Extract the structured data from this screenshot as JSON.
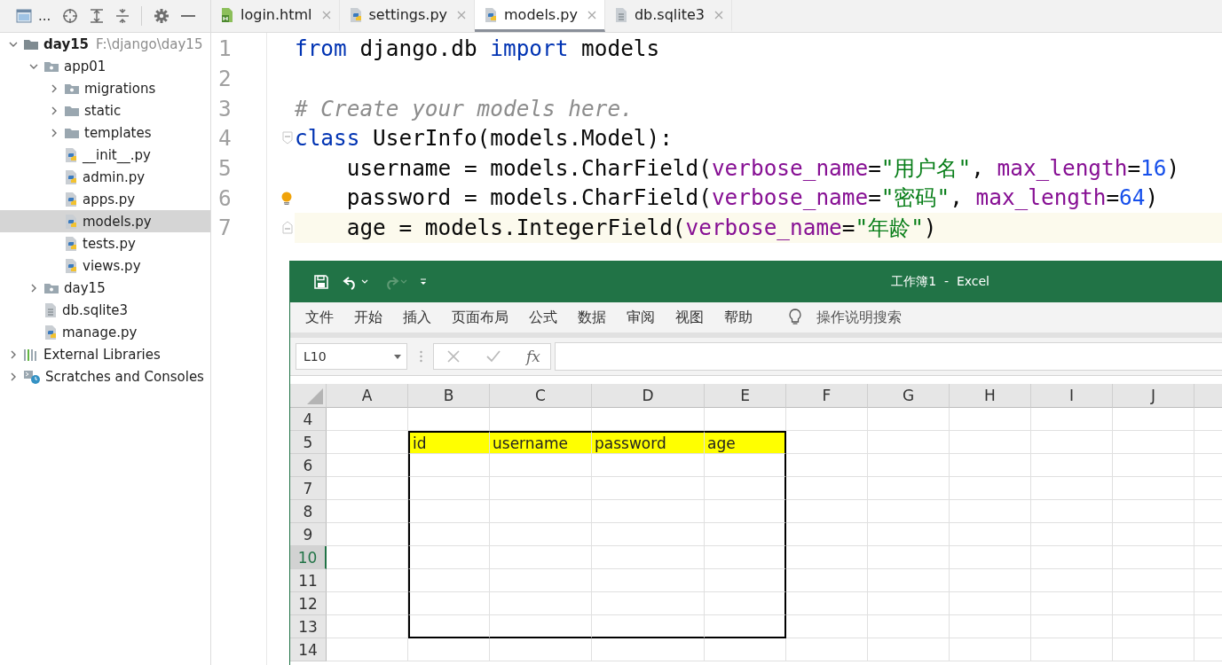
{
  "ide": {
    "toolbar": {
      "project_label": "..."
    },
    "tabs": [
      {
        "label": "login.html",
        "kind": "html",
        "selected": false
      },
      {
        "label": "settings.py",
        "kind": "python",
        "selected": false
      },
      {
        "label": "models.py",
        "kind": "python",
        "selected": true
      },
      {
        "label": "db.sqlite3",
        "kind": "text",
        "selected": false
      }
    ],
    "project_tree": [
      {
        "label": "day15",
        "path": "F:\\django\\day15",
        "kind": "root",
        "expanded": true,
        "selected": false,
        "children": [
          {
            "label": "app01",
            "kind": "package",
            "expanded": true,
            "selected": false,
            "children": [
              {
                "label": "migrations",
                "kind": "package",
                "expanded": false,
                "selected": false
              },
              {
                "label": "static",
                "kind": "folder",
                "expanded": false,
                "selected": false
              },
              {
                "label": "templates",
                "kind": "folder",
                "expanded": false,
                "selected": false
              },
              {
                "label": "__init__.py",
                "kind": "python",
                "selected": false
              },
              {
                "label": "admin.py",
                "kind": "python",
                "selected": false
              },
              {
                "label": "apps.py",
                "kind": "python",
                "selected": false
              },
              {
                "label": "models.py",
                "kind": "python",
                "selected": true
              },
              {
                "label": "tests.py",
                "kind": "python",
                "selected": false
              },
              {
                "label": "views.py",
                "kind": "python",
                "selected": false
              }
            ]
          },
          {
            "label": "day15",
            "kind": "package",
            "expanded": false,
            "selected": false
          },
          {
            "label": "db.sqlite3",
            "kind": "text",
            "selected": false
          },
          {
            "label": "manage.py",
            "kind": "python",
            "selected": false
          }
        ]
      },
      {
        "label": "External Libraries",
        "kind": "library",
        "expanded": false,
        "selected": false
      },
      {
        "label": "Scratches and Consoles",
        "kind": "scratches",
        "expanded": false,
        "selected": false
      }
    ],
    "editor": {
      "lines": [
        {
          "number": "1",
          "kind": "plain",
          "current": false,
          "tokens": [
            {
              "kind": "keyword",
              "text": "from"
            },
            {
              "kind": "plain",
              "text": " django.db "
            },
            {
              "kind": "keyword",
              "text": "import"
            },
            {
              "kind": "plain",
              "text": " models"
            }
          ]
        },
        {
          "number": "2",
          "kind": "plain",
          "current": false
        },
        {
          "number": "3",
          "kind": "plain",
          "current": false,
          "tokens": [
            {
              "kind": "comment",
              "text": "# Create your models here."
            }
          ]
        },
        {
          "number": "4",
          "kind": "fold-start",
          "current": false,
          "tokens": [
            {
              "kind": "keyword",
              "text": "class"
            },
            {
              "kind": "plain",
              "text": " UserInfo(models.Model):"
            }
          ]
        },
        {
          "number": "5",
          "kind": "plain",
          "current": false,
          "tokens": [
            {
              "kind": "plain",
              "text": "    username = models.CharField("
            },
            {
              "kind": "param",
              "text": "verbose_name"
            },
            {
              "kind": "plain",
              "text": "="
            },
            {
              "kind": "string",
              "text": "\"用户名\""
            },
            {
              "kind": "plain",
              "text": ", "
            },
            {
              "kind": "param",
              "text": "max_length"
            },
            {
              "kind": "plain",
              "text": "="
            },
            {
              "kind": "number",
              "text": "16"
            },
            {
              "kind": "plain",
              "text": ")"
            }
          ]
        },
        {
          "number": "6",
          "kind": "bulb",
          "current": false,
          "tokens": [
            {
              "kind": "plain",
              "text": "    password = models.CharField("
            },
            {
              "kind": "param",
              "text": "verbose_name"
            },
            {
              "kind": "plain",
              "text": "="
            },
            {
              "kind": "string",
              "text": "\"密码\""
            },
            {
              "kind": "plain",
              "text": ", "
            },
            {
              "kind": "param",
              "text": "max_length"
            },
            {
              "kind": "plain",
              "text": "="
            },
            {
              "kind": "number",
              "text": "64"
            },
            {
              "kind": "plain",
              "text": ")"
            }
          ]
        },
        {
          "number": "7",
          "kind": "fold-end",
          "current": true,
          "tokens": [
            {
              "kind": "plain",
              "text": "    age = models.IntegerField("
            },
            {
              "kind": "param",
              "text": "verbose_name"
            },
            {
              "kind": "plain",
              "text": "="
            },
            {
              "kind": "string",
              "text": "\"年龄\""
            },
            {
              "kind": "plain",
              "text": ")"
            }
          ]
        }
      ]
    }
  },
  "excel": {
    "title": "工作簿1  -  Excel",
    "menu": [
      "文件",
      "开始",
      "插入",
      "页面布局",
      "公式",
      "数据",
      "审阅",
      "视图",
      "帮助"
    ],
    "search": "操作说明搜索",
    "name_box": "L10",
    "function_label": "fx",
    "columns": [
      "A",
      "B",
      "C",
      "D",
      "E",
      "F",
      "G",
      "H",
      "I",
      "J"
    ],
    "rows": [
      {
        "number": "4",
        "selected": false
      },
      {
        "number": "5",
        "selected": false,
        "cells": [
          {
            "text": "",
            "highlighted": false
          },
          {
            "text": "id",
            "highlighted": true
          },
          {
            "text": "username",
            "highlighted": true
          },
          {
            "text": "password",
            "highlighted": true
          },
          {
            "text": "age",
            "highlighted": true
          }
        ]
      },
      {
        "number": "6",
        "selected": false
      },
      {
        "number": "7",
        "selected": false
      },
      {
        "number": "8",
        "selected": false
      },
      {
        "number": "9",
        "selected": false
      },
      {
        "number": "10",
        "selected": true
      },
      {
        "number": "11",
        "selected": false
      },
      {
        "number": "12",
        "selected": false
      },
      {
        "number": "13",
        "selected": false
      },
      {
        "number": "14",
        "selected": false
      }
    ]
  }
}
